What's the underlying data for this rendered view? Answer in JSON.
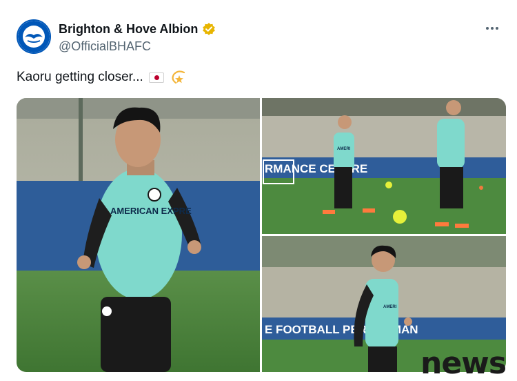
{
  "account": {
    "display_name": "Brighton & Hove Albion",
    "handle": "@OfficialBHAFC",
    "verified": true,
    "badge_color": "#e8b500",
    "avatar_icon": "club-crest-icon"
  },
  "tweet": {
    "text": "Kaoru getting closer...",
    "emojis": [
      "japan-flag-icon",
      "dizzy-star-icon"
    ]
  },
  "menu": {
    "icon": "more-options-icon"
  },
  "media": {
    "photo_count": 3,
    "photo1": {
      "sponsor_text": "AMERICAN EXPRE"
    },
    "photo2": {
      "banner_text": "RMANCE CENTRE",
      "sponsor_text": "AMERI"
    },
    "photo3": {
      "banner_text": "E FOOTBALL PERFORMAN",
      "sponsor_text": "AMERI"
    }
  },
  "watermark": {
    "text": "news"
  },
  "colors": {
    "kit_teal": "#7fd9cc",
    "pitch_green": "#4d8a3f",
    "banner_blue": "#2f5d9a",
    "brand_blue": "#0057b8"
  }
}
